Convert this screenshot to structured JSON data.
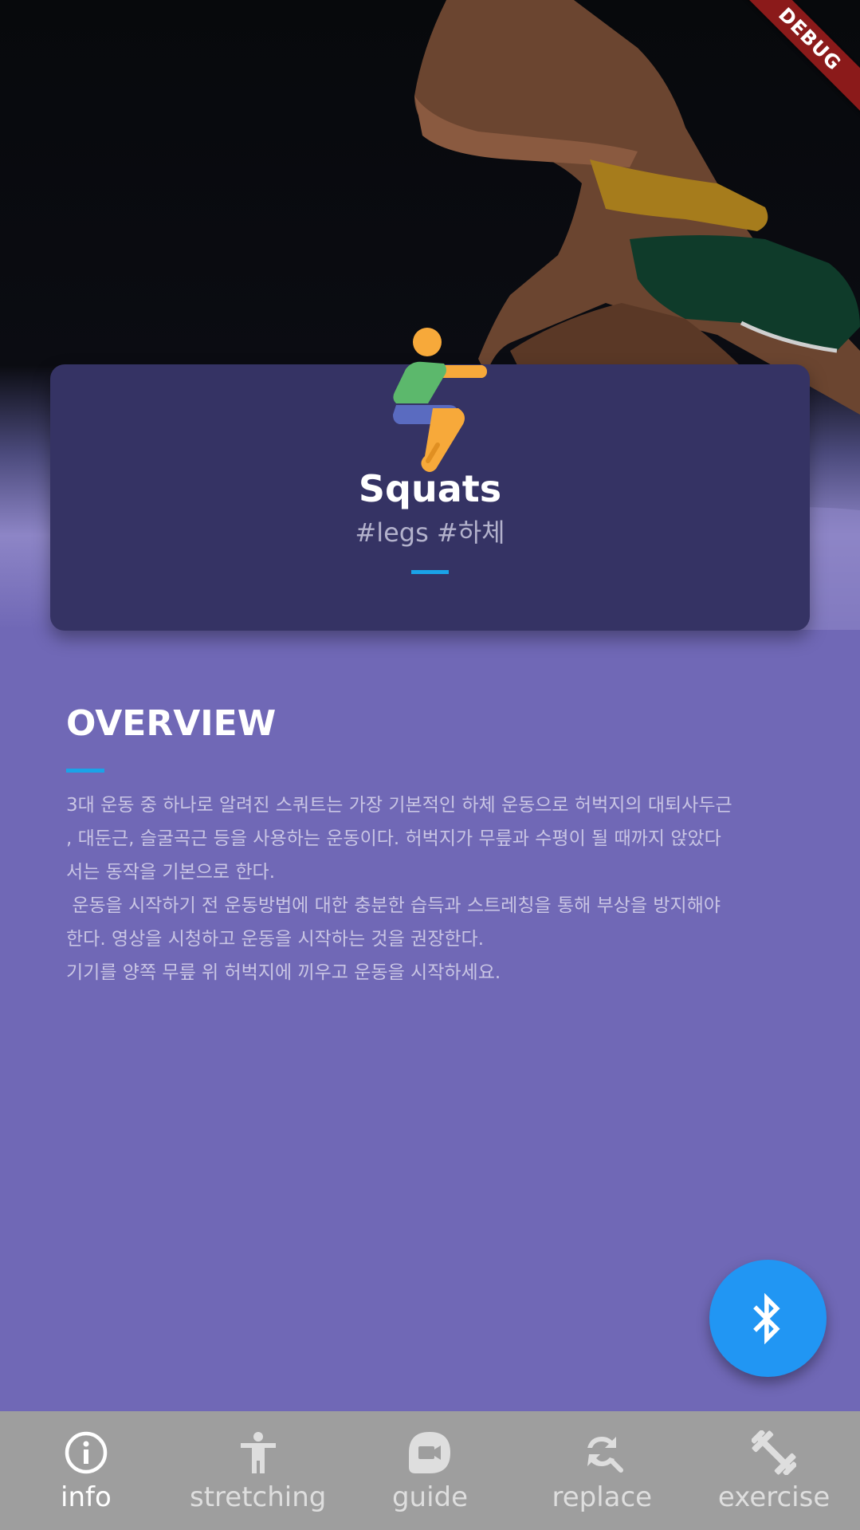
{
  "debug_banner": "DEBUG",
  "exercise": {
    "title": "Squats",
    "tags": "#legs #하체"
  },
  "overview": {
    "heading": "OVERVIEW",
    "body": "3대 운동 중 하나로 알려진 스쿼트는 가장 기본적인 하체 운동으로 허벅지의 대퇴사두근\n, 대둔근, 슬굴곡근 등을 사용하는 운동이다. 허벅지가 무릎과 수평이 될 때까지 앉았다\n서는 동작을 기본으로 한다.\n 운동을 시작하기 전 운동방법에 대한 충분한 습득과 스트레칭을 통해 부상을 방지해야\n한다. 영상을 시청하고 운동을 시작하는 것을 권장한다.\n기기를 양쪽 무릎 위 허벅지에 끼우고 운동을 시작하세요."
  },
  "fab": {
    "icon": "bluetooth-icon"
  },
  "bottom_nav": {
    "items": [
      {
        "label": "info",
        "icon": "info-icon",
        "active": true
      },
      {
        "label": "stretching",
        "icon": "accessibility-icon",
        "active": false
      },
      {
        "label": "guide",
        "icon": "video-icon",
        "active": false
      },
      {
        "label": "replace",
        "icon": "find-replace-icon",
        "active": false
      },
      {
        "label": "exercise",
        "icon": "dumbbell-icon",
        "active": false
      }
    ]
  },
  "colors": {
    "background": "#7068b6",
    "card": "#353364",
    "accent": "#1aa3e8",
    "fab": "#2196f3",
    "nav": "#9e9e9e",
    "debug": "#8b1a1a"
  }
}
